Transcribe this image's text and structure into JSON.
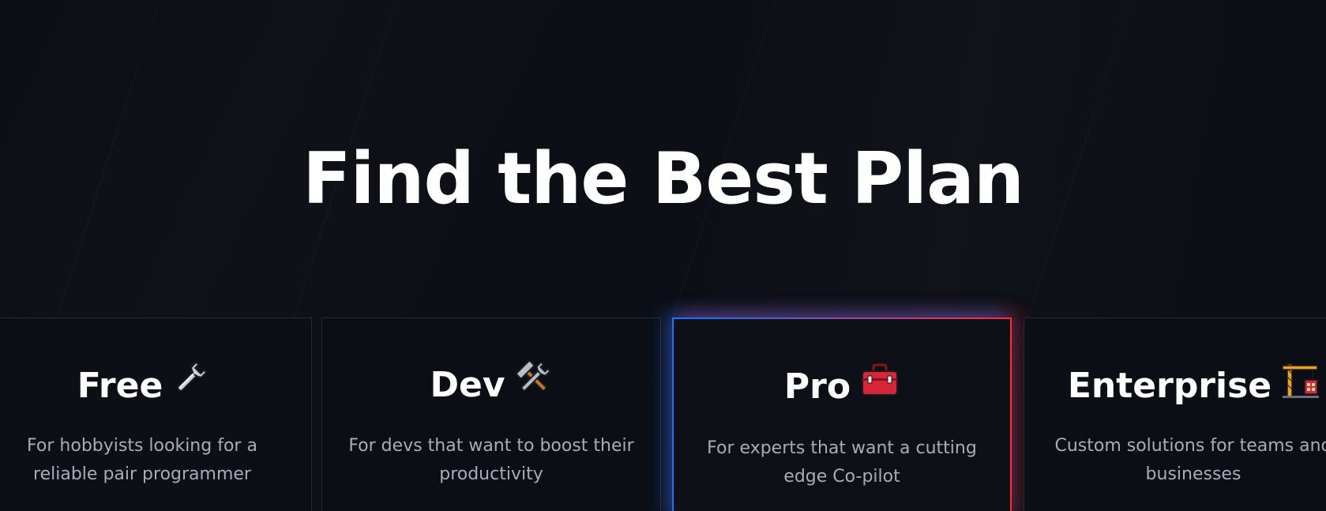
{
  "heading": "Find the Best Plan",
  "plans": [
    {
      "name": "Free",
      "icon": "wrench-icon",
      "description": "For hobbyists looking for a reliable pair programmer"
    },
    {
      "name": "Dev",
      "icon": "hammer-and-wrench-icon",
      "description": "For devs that want to boost their productivity"
    },
    {
      "name": "Pro",
      "icon": "toolbox-icon",
      "description": "For experts that want a cutting edge Co-pilot"
    },
    {
      "name": "Enterprise",
      "icon": "construction-crane-icon",
      "description": "Custom solutions for teams and businesses"
    }
  ],
  "colors": {
    "background": "#0c0f15",
    "card_border": "#262a31",
    "pro_border_start": "#1a73ff",
    "pro_border_end": "#ff2a3a",
    "heading_text": "#ffffff",
    "description_text": "#a7adb7"
  }
}
